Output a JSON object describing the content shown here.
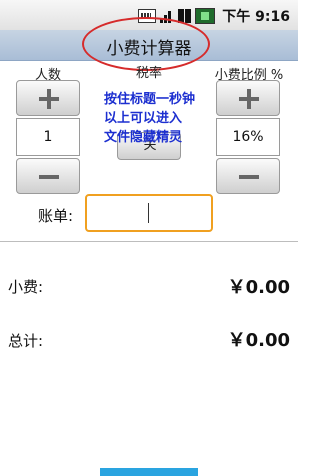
{
  "status": {
    "time": "下午 9:16"
  },
  "app": {
    "title": "小费计算器"
  },
  "columns": {
    "people": "人数",
    "tax": "税率",
    "tip_pct": "小费比例 %"
  },
  "people": {
    "value": "1"
  },
  "tax": {
    "button_label": "关"
  },
  "tip": {
    "value": "16%"
  },
  "overlay_note": {
    "line1": "按住标题一秒钟",
    "line2": "以上可以进入",
    "line3": "文件隐藏精灵"
  },
  "bill": {
    "label": "账单:",
    "value": ""
  },
  "results": {
    "tip_label": "小费:",
    "tip_value": "￥0.00",
    "total_label": "总计:",
    "total_value": "￥0.00"
  },
  "colors": {
    "annotation_red": "#d62b2b",
    "annotation_blue": "#1c2fd0",
    "focus_orange": "#f0a020",
    "accent_blue": "#2aa4e0"
  },
  "icons": [
    "keyboard-icon",
    "signal-icon",
    "battery-icon"
  ]
}
